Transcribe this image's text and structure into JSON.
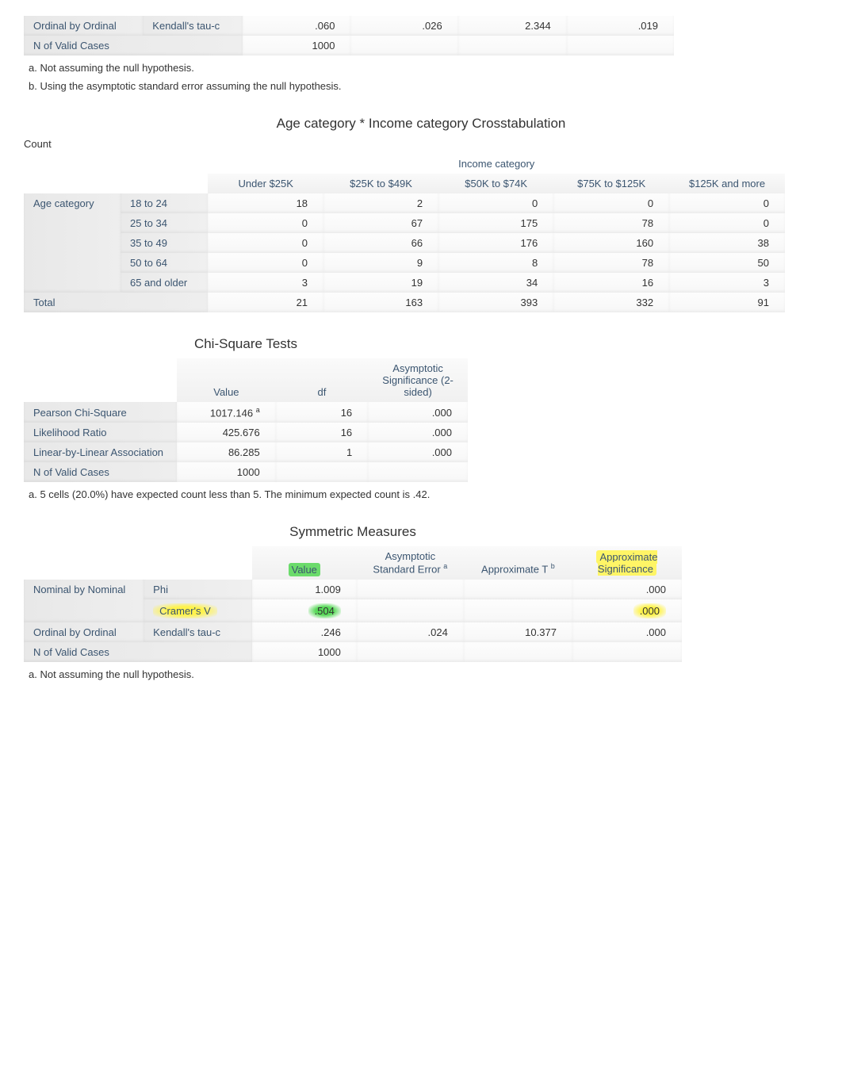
{
  "top_symmetric": {
    "rows": [
      {
        "cat": "Ordinal by Ordinal",
        "measure": "Kendall's tau-c",
        "v1": ".060",
        "v2": ".026",
        "v3": "2.344",
        "v4": ".019"
      },
      {
        "cat": "N of Valid Cases",
        "measure": "",
        "v1": "1000",
        "v2": "",
        "v3": "",
        "v4": ""
      }
    ],
    "footnotes": [
      "a. Not assuming the null hypothesis.",
      "b. Using the asymptotic standard error assuming the null hypothesis."
    ]
  },
  "crosstab": {
    "title": "Age category * Income category Crosstabulation",
    "count_label": "Count",
    "span_header": "Income category",
    "columns": [
      "Under $25K",
      "$25K to $49K",
      "$50K to $74K",
      "$75K to $125K",
      "$125K and more"
    ],
    "row_group": "Age category",
    "rows": [
      {
        "label": "18 to 24",
        "vals": [
          "18",
          "2",
          "0",
          "0",
          "0"
        ]
      },
      {
        "label": "25 to 34",
        "vals": [
          "0",
          "67",
          "175",
          "78",
          "0"
        ]
      },
      {
        "label": "35 to 49",
        "vals": [
          "0",
          "66",
          "176",
          "160",
          "38"
        ]
      },
      {
        "label": "50 to 64",
        "vals": [
          "0",
          "9",
          "8",
          "78",
          "50"
        ]
      },
      {
        "label": "65 and older",
        "vals": [
          "3",
          "19",
          "34",
          "16",
          "3"
        ]
      }
    ],
    "total_label": "Total",
    "totals": [
      "21",
      "163",
      "393",
      "332",
      "91"
    ]
  },
  "chisq": {
    "title": "Chi-Square Tests",
    "headers": [
      "Value",
      "df",
      "Asymptotic Significance (2-sided)"
    ],
    "rows": [
      {
        "label": "Pearson Chi-Square",
        "value": "1017.146",
        "sup": "a",
        "df": "16",
        "sig": ".000"
      },
      {
        "label": "Likelihood Ratio",
        "value": "425.676",
        "sup": "",
        "df": "16",
        "sig": ".000"
      },
      {
        "label": "Linear-by-Linear Association",
        "value": "86.285",
        "sup": "",
        "df": "1",
        "sig": ".000"
      },
      {
        "label": "N of Valid Cases",
        "value": "1000",
        "sup": "",
        "df": "",
        "sig": ""
      }
    ],
    "footnote": "a. 5 cells (20.0%) have expected count less than 5. The minimum expected count is .42."
  },
  "symmetric": {
    "title": "Symmetric Measures",
    "headers": {
      "value": "Value",
      "ase": "Asymptotic Standard Error",
      "ase_sup": "a",
      "approxT": "Approximate T",
      "approxT_sup": "b",
      "approxSig": "Approximate Significance"
    },
    "rows": [
      {
        "cat": "Nominal by Nominal",
        "measure": "Phi",
        "value": "1.009",
        "ase": "",
        "t": "",
        "sig": ".000",
        "hl_measure": false,
        "hl_value": false,
        "hl_sig": false
      },
      {
        "cat": "",
        "measure": "Cramer's V",
        "value": ".504",
        "ase": "",
        "t": "",
        "sig": ".000",
        "hl_measure": true,
        "hl_value": true,
        "hl_sig": true
      },
      {
        "cat": "Ordinal by Ordinal",
        "measure": "Kendall's tau-c",
        "value": ".246",
        "ase": ".024",
        "t": "10.377",
        "sig": ".000",
        "hl_measure": false,
        "hl_value": false,
        "hl_sig": false
      },
      {
        "cat": "N of Valid Cases",
        "measure": "",
        "value": "1000",
        "ase": "",
        "t": "",
        "sig": "",
        "hl_measure": false,
        "hl_value": false,
        "hl_sig": false
      }
    ],
    "footnote": "a. Not assuming the null hypothesis."
  }
}
